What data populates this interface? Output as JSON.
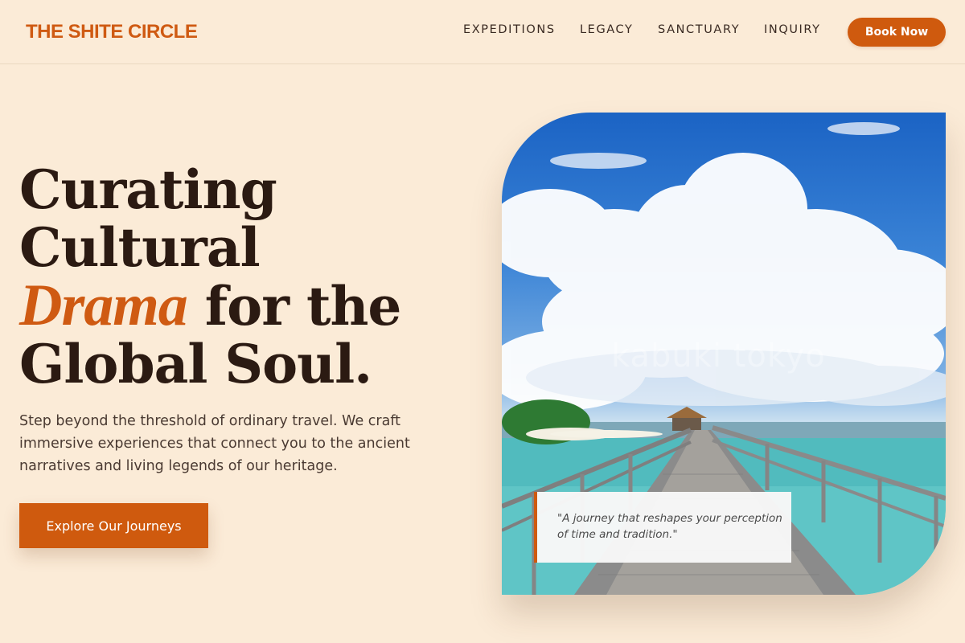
{
  "brand": {
    "name": "THE SHITE CIRCLE",
    "accent_color": "#cf5a0e",
    "background_color": "#fbebd7"
  },
  "nav": {
    "items": [
      {
        "label": "EXPEDITIONS"
      },
      {
        "label": "LEGACY"
      },
      {
        "label": "SANCTUARY"
      },
      {
        "label": "INQUIRY"
      }
    ],
    "book_label": "Book Now"
  },
  "hero": {
    "headline": {
      "line1": "Curating",
      "line2": "Cultural",
      "accent": "Drama",
      "line3_rest": " for the",
      "line4": "Global Soul."
    },
    "subtext": "Step beyond the threshold of ordinary travel. We craft immersive experiences that connect you to the ancient narratives and living legends of our heritage.",
    "cta_label": "Explore Our Journeys",
    "image": {
      "description_icon": "ocean-boardwalk-photo",
      "watermark": "kabuki tokyo"
    },
    "quote": "\"A journey that reshapes your perception of time and tradition.\""
  }
}
